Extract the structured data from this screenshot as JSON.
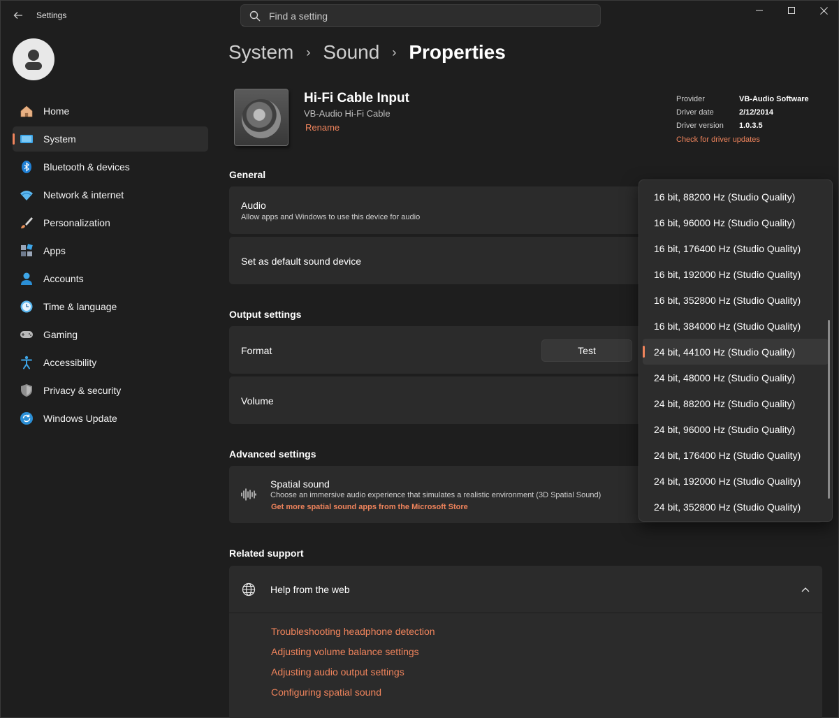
{
  "window": {
    "title": "Settings"
  },
  "search": {
    "placeholder": "Find a setting"
  },
  "sidebar": {
    "items": [
      {
        "label": "Home",
        "icon": "home-icon"
      },
      {
        "label": "System",
        "icon": "system-icon",
        "active": true
      },
      {
        "label": "Bluetooth & devices",
        "icon": "bluetooth-icon"
      },
      {
        "label": "Network & internet",
        "icon": "wifi-icon"
      },
      {
        "label": "Personalization",
        "icon": "brush-icon"
      },
      {
        "label": "Apps",
        "icon": "apps-icon"
      },
      {
        "label": "Accounts",
        "icon": "accounts-icon"
      },
      {
        "label": "Time & language",
        "icon": "clock-icon"
      },
      {
        "label": "Gaming",
        "icon": "gamepad-icon"
      },
      {
        "label": "Accessibility",
        "icon": "accessibility-icon"
      },
      {
        "label": "Privacy & security",
        "icon": "shield-icon"
      },
      {
        "label": "Windows Update",
        "icon": "update-icon"
      }
    ]
  },
  "breadcrumb": {
    "items": [
      "System",
      "Sound",
      "Properties"
    ],
    "separator": "›"
  },
  "device": {
    "name": "Hi-Fi Cable Input",
    "subtitle": "VB-Audio Hi-Fi Cable",
    "rename_label": "Rename"
  },
  "driver": {
    "provider_label": "Provider",
    "provider_value": "VB-Audio Software",
    "date_label": "Driver date",
    "date_value": "2/12/2014",
    "version_label": "Driver version",
    "version_value": "1.0.3.5",
    "check_link": "Check for driver updates"
  },
  "general": {
    "title": "General",
    "audio_title": "Audio",
    "audio_desc": "Allow apps and Windows to use this device for audio",
    "default_title": "Set as default sound device"
  },
  "output": {
    "title": "Output settings",
    "format_title": "Format",
    "test_label": "Test",
    "volume_title": "Volume"
  },
  "advanced": {
    "title": "Advanced settings",
    "spatial_title": "Spatial sound",
    "spatial_desc": "Choose an immersive audio experience that simulates a realistic environment (3D Spatial Sound)",
    "spatial_link": "Get more spatial sound apps from the Microsoft Store"
  },
  "support": {
    "title": "Related support",
    "help_title": "Help from the web",
    "links": [
      "Troubleshooting headphone detection",
      "Adjusting volume balance settings",
      "Adjusting audio output settings",
      "Configuring spatial sound"
    ]
  },
  "format_dropdown": {
    "selected_index": 6,
    "options": [
      "16 bit, 88200 Hz (Studio Quality)",
      "16 bit, 96000 Hz (Studio Quality)",
      "16 bit, 176400 Hz (Studio Quality)",
      "16 bit, 192000 Hz (Studio Quality)",
      "16 bit, 352800 Hz (Studio Quality)",
      "16 bit, 384000 Hz (Studio Quality)",
      "24 bit, 44100 Hz (Studio Quality)",
      "24 bit, 48000 Hz (Studio Quality)",
      "24 bit, 88200 Hz (Studio Quality)",
      "24 bit, 96000 Hz (Studio Quality)",
      "24 bit, 176400 Hz (Studio Quality)",
      "24 bit, 192000 Hz (Studio Quality)",
      "24 bit, 352800 Hz (Studio Quality)"
    ]
  },
  "colors": {
    "accent": "#f0845c",
    "background": "#1e1e1e",
    "card": "#2b2b2b"
  }
}
